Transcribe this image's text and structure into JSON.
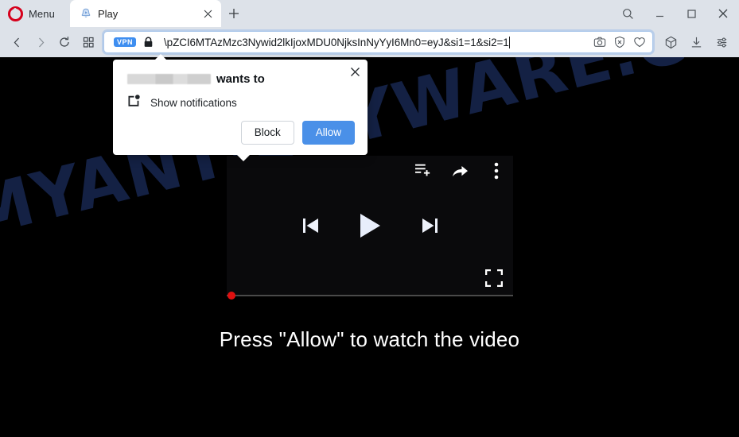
{
  "browser": {
    "name": "Opera",
    "menu_label": "Menu",
    "tabs": [
      {
        "title": "Play",
        "favicon": "play-favicon",
        "active": true
      }
    ],
    "new_tab_label": "+",
    "window_controls": [
      {
        "name": "search-icon",
        "glyph": "search"
      },
      {
        "name": "minimize-button",
        "glyph": "minimize"
      },
      {
        "name": "maximize-button",
        "glyph": "maximize"
      },
      {
        "name": "close-window-button",
        "glyph": "close"
      }
    ],
    "nav_buttons": [
      {
        "name": "back-button",
        "glyph": "chevron-left"
      },
      {
        "name": "forward-button",
        "glyph": "chevron-right"
      },
      {
        "name": "reload-button",
        "glyph": "reload"
      },
      {
        "name": "tab-grid-button",
        "glyph": "grid"
      }
    ],
    "address_bar": {
      "vpn_badge": "VPN",
      "security_icon": "lock-icon",
      "url": "\\pZCI6MTAzMzc3Nywid2lkIjoxMDU0NjksInNyYyI6Mn0=eyJ&si1=1&si2=1",
      "inline_icons": [
        {
          "name": "snapshot-icon",
          "glyph": "camera"
        },
        {
          "name": "ad-blocker-icon",
          "glyph": "shield-x"
        },
        {
          "name": "favorite-icon",
          "glyph": "heart"
        }
      ]
    },
    "toolbar_icons": [
      {
        "name": "workspaces-icon",
        "glyph": "cube"
      },
      {
        "name": "downloads-icon",
        "glyph": "download"
      },
      {
        "name": "easy-setup-icon",
        "glyph": "sliders"
      }
    ]
  },
  "permission_dialog": {
    "origin": "[redacted]",
    "title_suffix": "wants to",
    "permission_icon": "notification-icon",
    "permission_label": "Show notifications",
    "block_label": "Block",
    "allow_label": "Allow",
    "close_label": "×",
    "allow_color": "#4a90e8"
  },
  "page": {
    "watermark": "MYANTISPYWARE.COM",
    "cta_text": "Press \"Allow\" to watch the video",
    "player": {
      "top_icons": [
        {
          "name": "add-to-playlist-icon",
          "glyph": "playlist-add"
        },
        {
          "name": "share-icon",
          "glyph": "share"
        },
        {
          "name": "more-options-icon",
          "glyph": "kebab"
        }
      ],
      "center_controls": [
        {
          "name": "previous-track-button",
          "glyph": "skip-previous"
        },
        {
          "name": "play-button",
          "glyph": "play"
        },
        {
          "name": "next-track-button",
          "glyph": "skip-next"
        }
      ],
      "fullscreen_icon": "fullscreen-icon",
      "progress_percent": 0,
      "progress_handle_color": "#e01010"
    }
  }
}
